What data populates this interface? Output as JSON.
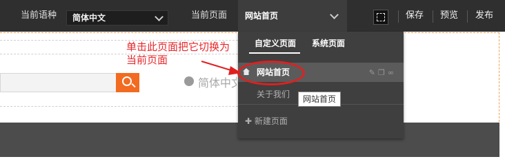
{
  "toolbar": {
    "language_label": "当前语种",
    "language_value": "简体中文",
    "page_label": "当前页面",
    "page_value": "网站首页",
    "save": "保存",
    "preview": "预览",
    "publish": "发布"
  },
  "canvas": {
    "language_text": "简体中文"
  },
  "annotation": {
    "line1": "单击此页面把它切换为",
    "line2": "当前页面"
  },
  "dropdown": {
    "tabs": [
      "自定义页面",
      "系统页面"
    ],
    "pages": [
      "网站首页",
      "关于我们"
    ],
    "new_page": "✚ 新建页面"
  },
  "tooltip": "网站首页",
  "colors": {
    "toolbar_bg": "#2f2f2f",
    "accent_orange": "#f26b21",
    "annotation_red": "#e8262a"
  }
}
